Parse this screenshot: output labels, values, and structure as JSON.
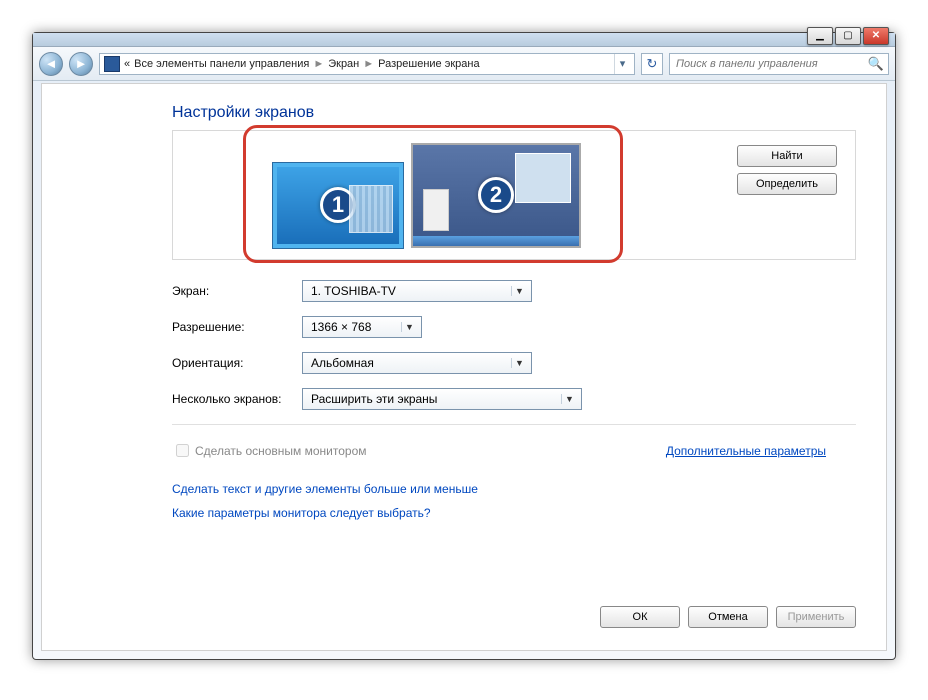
{
  "window_controls": {
    "minimize_glyph": "▁",
    "maximize_glyph": "▢",
    "close_glyph": "✕"
  },
  "nav": {
    "back_glyph": "◄",
    "forward_glyph": "►",
    "refresh_glyph": "↻",
    "dropdown_glyph": "▾"
  },
  "breadcrumb": {
    "overflow": "«",
    "item1": "Все элементы панели управления",
    "item2": "Экран",
    "item3": "Разрешение экрана",
    "sep_glyph": "►"
  },
  "search": {
    "placeholder": "Поиск в панели управления",
    "icon_glyph": "🔍"
  },
  "page": {
    "title": "Настройки экранов"
  },
  "monitors": {
    "items": [
      {
        "number": "1",
        "selected": true
      },
      {
        "number": "2",
        "selected": false
      }
    ]
  },
  "side_buttons": {
    "find": "Найти",
    "identify": "Определить"
  },
  "form": {
    "screen_label": "Экран:",
    "screen_value": "1. TOSHIBA-TV",
    "resolution_label": "Разрешение:",
    "resolution_value": "1366 × 768",
    "orientation_label": "Ориентация:",
    "orientation_value": "Альбомная",
    "multi_label": "Несколько экранов:",
    "multi_value": "Расширить эти экраны",
    "main_monitor_label": "Сделать основным монитором",
    "advanced_link": "Дополнительные параметры"
  },
  "links": {
    "text_size": "Сделать текст и другие элементы больше или меньше",
    "which_settings": "Какие параметры монитора следует выбрать?"
  },
  "buttons": {
    "ok": "ОК",
    "cancel": "Отмена",
    "apply": "Применить"
  },
  "dropdown_arrow": "▼"
}
